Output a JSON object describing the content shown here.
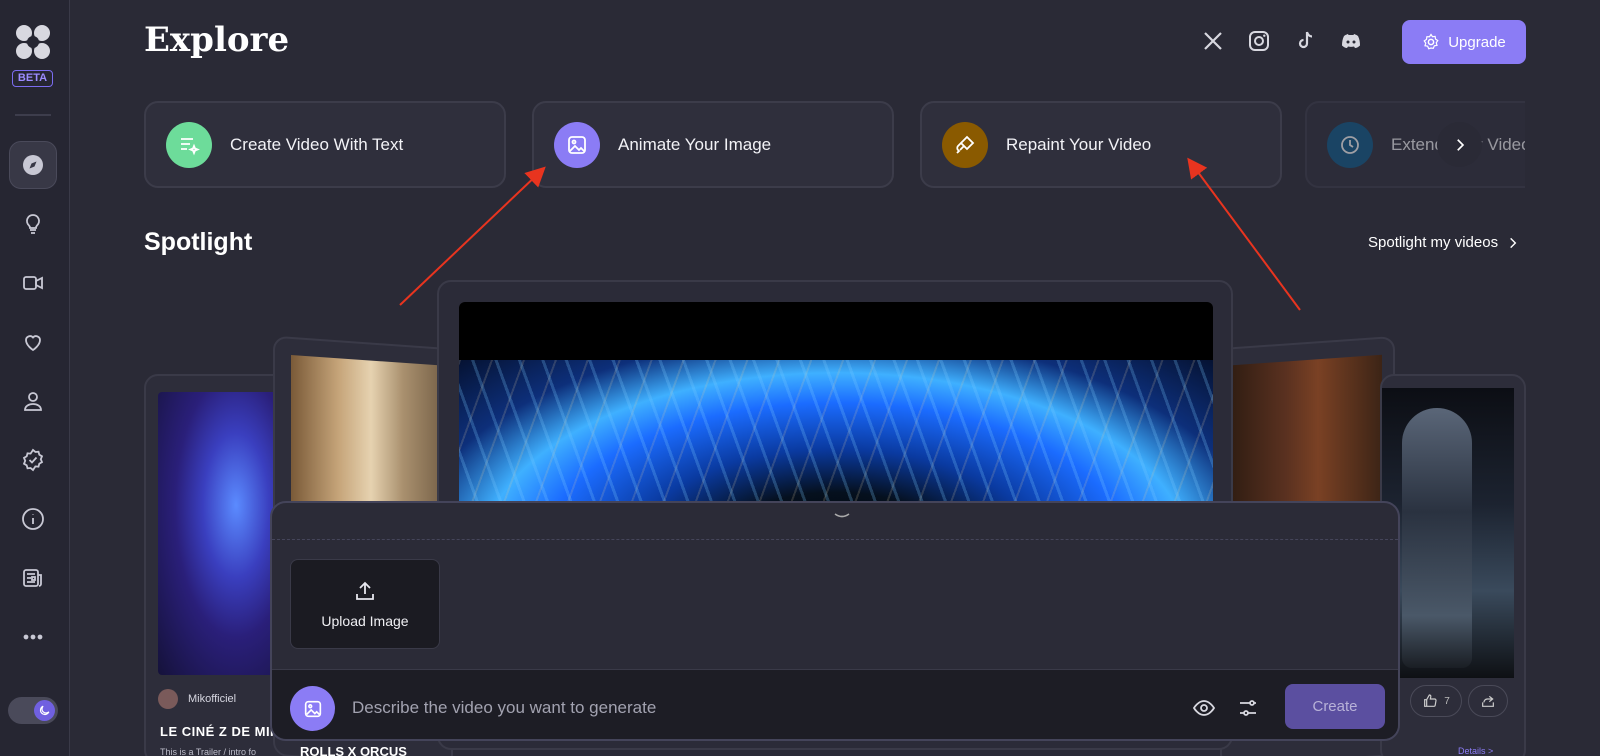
{
  "sidebar": {
    "badge": "BETA",
    "items": [
      {
        "name": "explore",
        "icon": "compass-icon"
      },
      {
        "name": "ideas",
        "icon": "lightbulb-icon"
      },
      {
        "name": "videos",
        "icon": "video-camera-icon"
      },
      {
        "name": "favorites",
        "icon": "heart-icon"
      },
      {
        "name": "profile",
        "icon": "user-icon"
      },
      {
        "name": "verified",
        "icon": "badge-check-icon"
      },
      {
        "name": "info",
        "icon": "info-icon"
      },
      {
        "name": "news",
        "icon": "newspaper-icon"
      },
      {
        "name": "more",
        "icon": "more-dots-icon"
      }
    ],
    "theme": "dark"
  },
  "header": {
    "title": "Explore",
    "socials": [
      "x-icon",
      "instagram-icon",
      "tiktok-icon",
      "discord-icon"
    ],
    "upgrade_label": "Upgrade"
  },
  "features": [
    {
      "label": "Create Video With Text",
      "color": "#6ddc9a"
    },
    {
      "label": "Animate Your Image",
      "color": "#8b7cf5"
    },
    {
      "label": "Repaint Your Video",
      "color": "#8a5a00"
    },
    {
      "label": "Extend Your Video",
      "color": "#0e5a8a"
    }
  ],
  "spotlight": {
    "title": "Spotlight",
    "link_label": "Spotlight my videos",
    "cards": [
      {
        "author": "Mikofficiel",
        "title": "LE CINÉ Z DE MIK",
        "desc": "This is a Trailer / intro fo"
      },
      {
        "title": "ROLLS X ORCUS"
      }
    ],
    "likes": "7",
    "details_label": "Details >"
  },
  "composer": {
    "upload_label": "Upload Image",
    "prompt_placeholder": "Describe the video you want to generate",
    "create_label": "Create"
  },
  "colors": {
    "accent": "#8b7cf5",
    "background": "#2a2a36",
    "arrow": "#e8341f"
  }
}
